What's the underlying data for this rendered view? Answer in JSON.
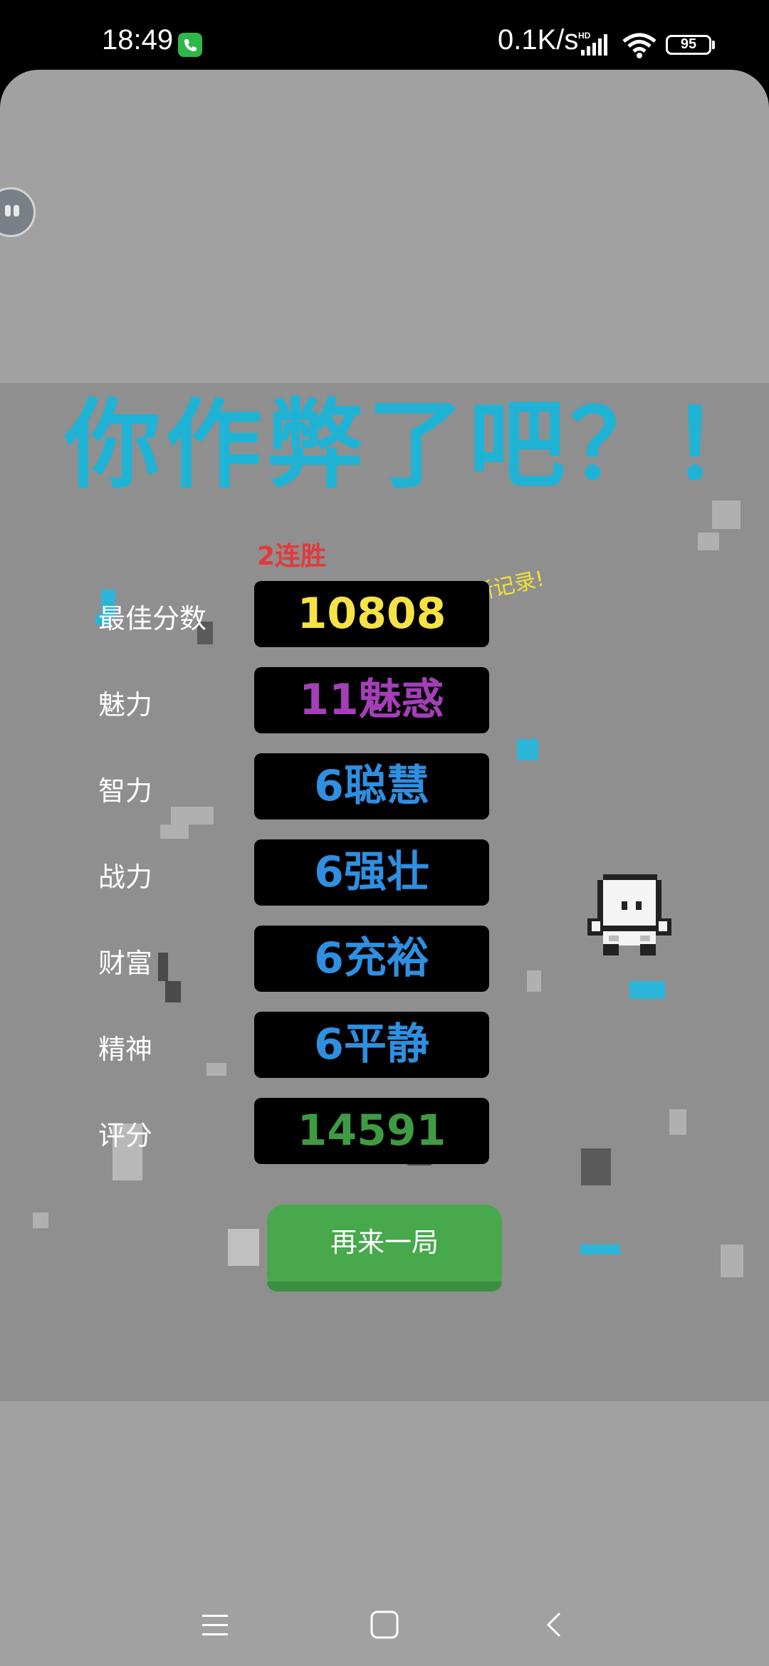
{
  "status_bar": {
    "time": "18:49",
    "net_speed": "0.1K/s",
    "network_badge": "HD",
    "battery": "95",
    "icons": [
      "phone-call-icon",
      "signal-icon",
      "wifi-icon",
      "battery-icon"
    ]
  },
  "game": {
    "title": "你作弊了吧？！",
    "streak": "2连胜",
    "new_record": "新记录!",
    "stats": [
      {
        "label": "最佳分数",
        "value": "10808",
        "color": "#f5e246"
      },
      {
        "label": "魅力",
        "value": "11魅惑",
        "color": "#a43fb8"
      },
      {
        "label": "智力",
        "value": "6聪慧",
        "color": "#2f8fe0"
      },
      {
        "label": "战力",
        "value": "6强壮",
        "color": "#2f8fe0"
      },
      {
        "label": "财富",
        "value": "6充裕",
        "color": "#2f8fe0"
      },
      {
        "label": "精神",
        "value": "6平静",
        "color": "#2f8fe0"
      },
      {
        "label": "评分",
        "value": "14591",
        "color": "#3f9a44"
      }
    ],
    "retry_button": "再来一局"
  },
  "nav_bar": {
    "icons": [
      "menu-icon",
      "home-icon",
      "back-icon"
    ]
  },
  "colors": {
    "title": "#1fb3d6",
    "button": "#47a84c",
    "panel": "#8f8f8f",
    "background": "#a1a1a1"
  }
}
